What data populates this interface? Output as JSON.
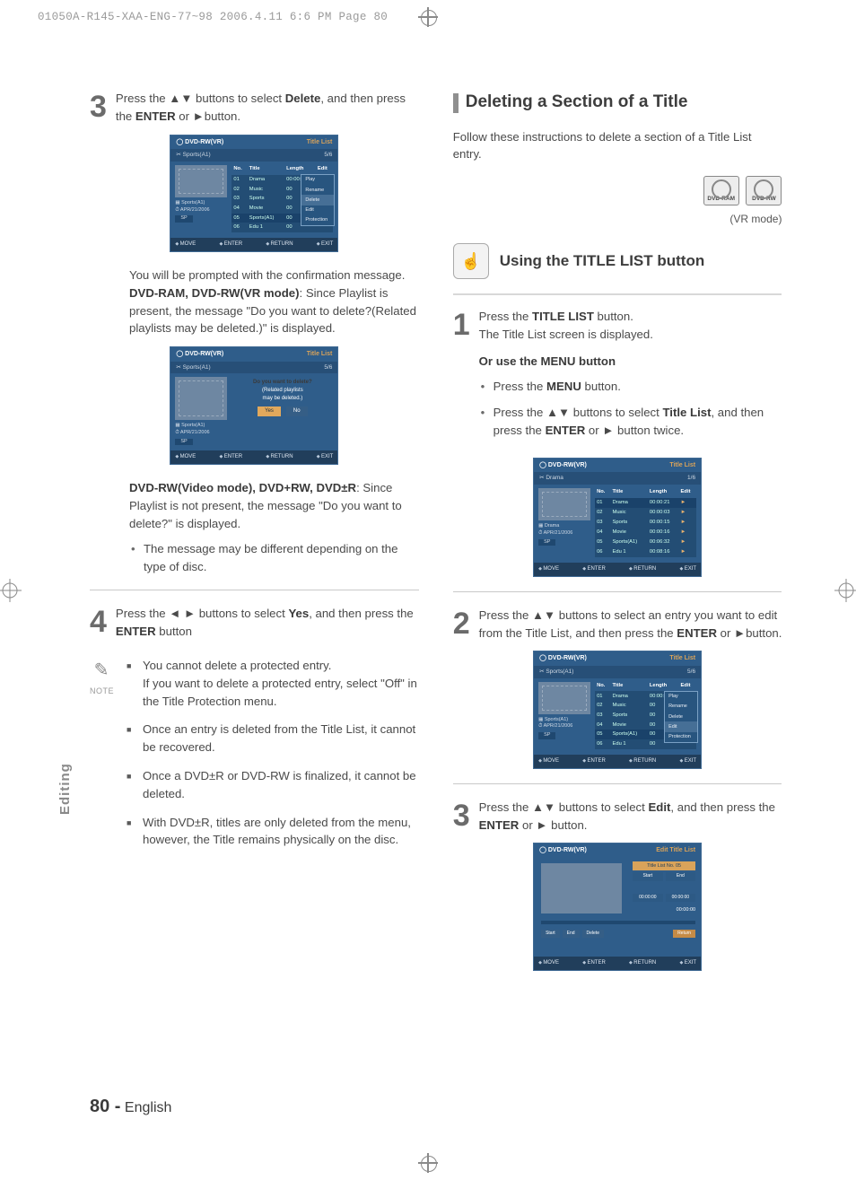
{
  "header_line": "01050A-R145-XAA-ENG-77~98  2006.4.11  6:6 PM  Page 80",
  "side_label": "Editing",
  "page_number": "80 -",
  "page_lang": "English",
  "left": {
    "step3": {
      "num": "3",
      "text_a": "Press the ▲▼ buttons to select ",
      "bold": "Delete",
      "text_b": ", and then press the ",
      "bold2": "ENTER",
      "text_c": " or ►button."
    },
    "osd1": {
      "model": "DVD-RW(VR)",
      "tl": "Title List",
      "sub_l": "Sports(A1)",
      "sub_r": "5/6",
      "headers": [
        "No.",
        "Title",
        "Length",
        "Edit"
      ],
      "rows": [
        {
          "n": "01",
          "t": "Drama",
          "l": "00:00:21",
          "e": "►"
        },
        {
          "n": "02",
          "t": "Music",
          "l": "00",
          "e": ""
        },
        {
          "n": "03",
          "t": "Sports",
          "l": "00",
          "e": ""
        },
        {
          "n": "04",
          "t": "Movie",
          "l": "00",
          "e": ""
        },
        {
          "n": "05",
          "t": "Sports(A1)",
          "l": "00",
          "e": ""
        },
        {
          "n": "06",
          "t": "Edu 1",
          "l": "00",
          "e": ""
        }
      ],
      "popup": [
        "Play",
        "Rename",
        "Delete",
        "Edit",
        "Protection"
      ],
      "popup_sel_idx": 2,
      "meta": {
        "t": "Sports(A1)",
        "d": "APR/21/2006",
        "m": "SP"
      },
      "foot": [
        "MOVE",
        "ENTER",
        "RETURN",
        "EXIT"
      ]
    },
    "para1_a": "You will be prompted with the confirmation message.",
    "para1_b_bold": "DVD-RAM, DVD-RW(VR mode)",
    "para1_b": ":  Since Playlist is present, the message \"Do you want to delete?(Related playlists may be deleted.)\" is displayed.",
    "osd2": {
      "model": "DVD-RW(VR)",
      "tl": "Title List",
      "sub_l": "Sports(A1)",
      "sub_r": "5/6",
      "confirm_l1": "Do you want to delete?",
      "confirm_l2": "(Related playlists",
      "confirm_l3": "may be deleted.)",
      "yes": "Yes",
      "no": "No",
      "meta": {
        "t": "Sports(A1)",
        "d": "APR/21/2006",
        "m": "SP"
      },
      "foot": [
        "MOVE",
        "ENTER",
        "RETURN",
        "EXIT"
      ]
    },
    "para2_bold": "DVD-RW(Video mode), DVD+RW, DVD±R",
    "para2": ":  Since Playlist is not present, the message \"Do you want to delete?\" is displayed.",
    "para3": "The message may be different depending on the type of disc.",
    "step4": {
      "num": "4",
      "a": "Press the ◄ ► buttons to select ",
      "b": "Yes",
      "c": ", and then press the ",
      "d": "ENTER",
      "e": " button"
    },
    "note_label": "NOTE",
    "notes": [
      "You cannot delete a protected entry.\nIf you want to delete a protected entry, select \"Off\" in the Title Protection menu.",
      "Once an entry is deleted from the Title List, it cannot be recovered.",
      "Once a DVD±R or DVD-RW is finalized, it cannot be deleted.",
      "With DVD±R, titles are only deleted from the menu, however, the Title remains physically on the disc."
    ]
  },
  "right": {
    "section_title": "Deleting a Section of a Title",
    "intro": "Follow these instructions to delete a section of a Title List entry.",
    "disc_icons": [
      "DVD-RAM",
      "DVD-RW"
    ],
    "vr_mode": "(VR mode)",
    "subhead": "Using the TITLE LIST button",
    "step1": {
      "num": "1",
      "l1a": "Press the ",
      "l1b": "TITLE LIST",
      "l1c": " button.",
      "l2": "The Title List screen is displayed.",
      "or": "Or use the MENU button",
      "b1a": "Press the ",
      "b1b": "MENU",
      "b1c": " button.",
      "b2a": "Press the ▲▼ buttons to select ",
      "b2b": "Title List",
      "b2c": ", and then press the ",
      "b2d": "ENTER",
      "b2e": " or ► button twice."
    },
    "osd1": {
      "model": "DVD-RW(VR)",
      "tl": "Title List",
      "sub_l": "Drama",
      "sub_r": "1/6",
      "headers": [
        "No.",
        "Title",
        "Length",
        "Edit"
      ],
      "rows": [
        {
          "n": "01",
          "t": "Drama",
          "l": "00:00:21",
          "e": "►"
        },
        {
          "n": "02",
          "t": "Music",
          "l": "00:00:03",
          "e": "►"
        },
        {
          "n": "03",
          "t": "Sports",
          "l": "00:00:15",
          "e": "►"
        },
        {
          "n": "04",
          "t": "Movie",
          "l": "00:00:16",
          "e": "►"
        },
        {
          "n": "05",
          "t": "Sports(A1)",
          "l": "00:06:32",
          "e": "►"
        },
        {
          "n": "06",
          "t": "Edu 1",
          "l": "00:08:16",
          "e": "►"
        }
      ],
      "meta": {
        "t": "Drama",
        "d": "APR/21/2006",
        "m": "SP"
      },
      "foot": [
        "MOVE",
        "ENTER",
        "RETURN",
        "EXIT"
      ]
    },
    "step2": {
      "num": "2",
      "a": "Press the ▲▼ buttons to select an entry you want to edit from the Title List, and then press the ",
      "b": "ENTER",
      "c": " or ►button."
    },
    "osd2": {
      "model": "DVD-RW(VR)",
      "tl": "Title List",
      "sub_l": "Sports(A1)",
      "sub_r": "5/6",
      "headers": [
        "No.",
        "Title",
        "Length",
        "Edit"
      ],
      "rows": [
        {
          "n": "01",
          "t": "Drama",
          "l": "00:00:21",
          "e": "►"
        },
        {
          "n": "02",
          "t": "Music",
          "l": "00",
          "e": ""
        },
        {
          "n": "03",
          "t": "Sports",
          "l": "00",
          "e": ""
        },
        {
          "n": "04",
          "t": "Movie",
          "l": "00",
          "e": ""
        },
        {
          "n": "05",
          "t": "Sports(A1)",
          "l": "00",
          "e": ""
        },
        {
          "n": "06",
          "t": "Edu 1",
          "l": "00",
          "e": ""
        }
      ],
      "popup": [
        "Play",
        "Rename",
        "Delete",
        "Edit",
        "Protection"
      ],
      "popup_sel_idx": 3,
      "meta": {
        "t": "Sports(A1)",
        "d": "APR/21/2006",
        "m": "SP"
      },
      "foot": [
        "MOVE",
        "ENTER",
        "RETURN",
        "EXIT"
      ]
    },
    "step3": {
      "num": "3",
      "a": "Press the ▲▼ buttons to select ",
      "b": "Edit",
      "c": ", and then press the ",
      "d": "ENTER",
      "e": " or ► button."
    },
    "osd3": {
      "model": "DVD-RW(VR)",
      "tl": "Edit Title List",
      "panel_title": "Title List  No.  05",
      "start": "Start",
      "end": "End",
      "t1": "00:00:00",
      "t2": "00:00:00",
      "tr": "00:00:00",
      "btns": [
        "Start",
        "End",
        "Delete"
      ],
      "ret": "Return",
      "foot": [
        "MOVE",
        "ENTER",
        "RETURN",
        "EXIT"
      ]
    }
  }
}
